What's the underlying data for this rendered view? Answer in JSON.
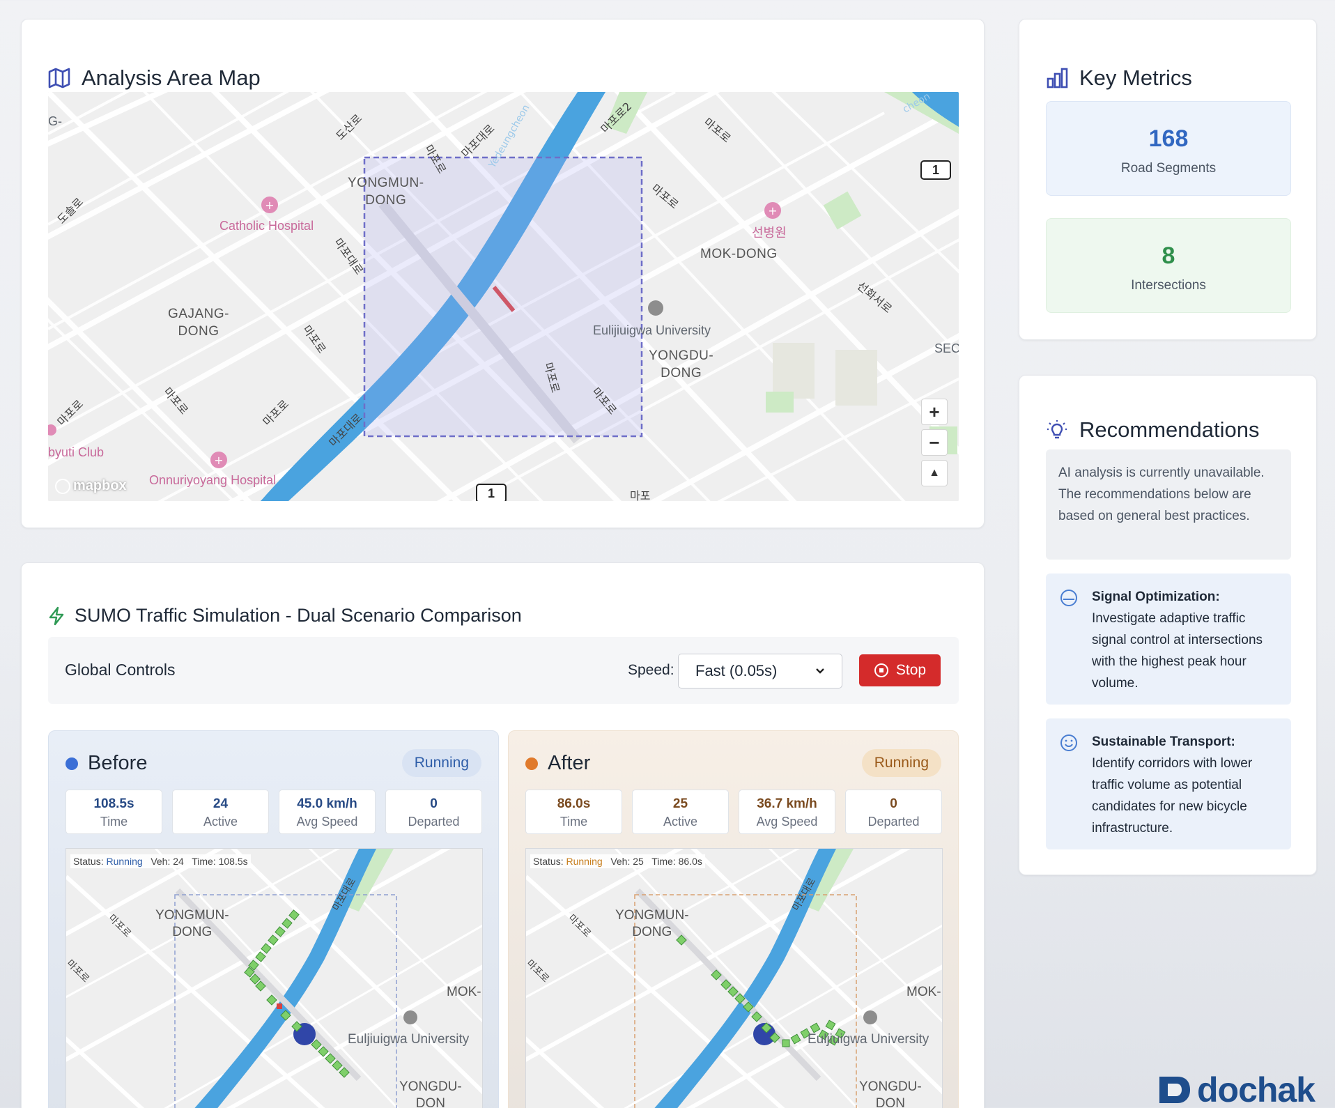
{
  "map_card": {
    "title": "Analysis Area Map",
    "labels": {
      "yongmun": "YONGMUN-\nDONG",
      "gajang": "GAJANG-\nDONG",
      "mok": "MOK-DONG",
      "yongdu": "YONGDU-\nDONG",
      "catholic": "Catholic Hospital",
      "eulji": "Eulijiuigwa University",
      "onnuri": "Onnuriyoyang Hospital",
      "club": "byuti Club",
      "hospital_kr": "선병원",
      "sec": "SEC"
    },
    "route_shield": "1",
    "attribution": "mapbox",
    "controls": {
      "zoom_in": "+",
      "zoom_out": "−",
      "compass": "▲"
    }
  },
  "metrics": {
    "title": "Key Metrics",
    "road_segments": {
      "value": "168",
      "label": "Road Segments"
    },
    "intersections": {
      "value": "8",
      "label": "Intersections"
    }
  },
  "recommendations": {
    "title": "Recommendations",
    "info": "AI analysis is currently unavailable. The recommendations below are based on general best practices.",
    "items": [
      {
        "title": "Signal Optimization:",
        "text": "Investigate adaptive traffic signal control at intersections with the highest peak hour volume.",
        "icon": "gauge-icon"
      },
      {
        "title": "Sustainable Transport:",
        "text": "Identify corridors with lower traffic volume as potential candidates for new bicycle infrastructure.",
        "icon": "smile-icon"
      }
    ]
  },
  "simulation": {
    "title": "SUMO Traffic Simulation - Dual Scenario Comparison",
    "controls_title": "Global Controls",
    "speed_label": "Speed:",
    "speed_value": "Fast (0.05s)",
    "stop_label": "Stop",
    "before": {
      "name": "Before",
      "status": "Running",
      "stats": [
        {
          "value": "108.5s",
          "label": "Time"
        },
        {
          "value": "24",
          "label": "Active"
        },
        {
          "value": "45.0 km/h",
          "label": "Avg Speed"
        },
        {
          "value": "0",
          "label": "Departed"
        }
      ],
      "map_status_label": "Status:",
      "map_status": "Running",
      "map_veh": "Veh: 24",
      "map_time": "Time: 108.5s"
    },
    "after": {
      "name": "After",
      "status": "Running",
      "stats": [
        {
          "value": "86.0s",
          "label": "Time"
        },
        {
          "value": "25",
          "label": "Active"
        },
        {
          "value": "36.7 km/h",
          "label": "Avg Speed"
        },
        {
          "value": "0",
          "label": "Departed"
        }
      ],
      "map_status_label": "Status:",
      "map_status": "Running",
      "map_veh": "Veh: 25",
      "map_time": "Time: 86.0s"
    },
    "mini_labels": {
      "yongmun": "YONGMUN-\nDONG",
      "mok": "MOK-",
      "eulji": "Euljiuigwa University",
      "yongdu": "YONGDU-\nDON"
    }
  },
  "colors": {
    "accent_blue": "#3167c1",
    "accent_green": "#2f8f4b",
    "stop_red": "#d42b2b",
    "before_dot": "#3b6fd6",
    "after_dot": "#e07a2c"
  },
  "logo": {
    "text": "dochak"
  }
}
